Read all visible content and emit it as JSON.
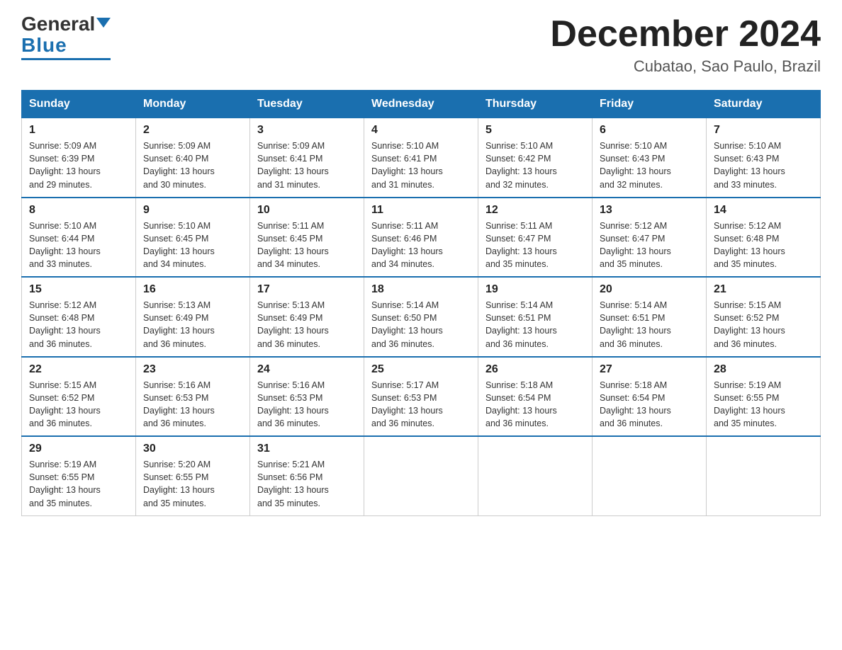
{
  "header": {
    "logo_general": "General",
    "logo_blue": "Blue",
    "month_title": "December 2024",
    "subtitle": "Cubatao, Sao Paulo, Brazil"
  },
  "days_of_week": [
    "Sunday",
    "Monday",
    "Tuesday",
    "Wednesday",
    "Thursday",
    "Friday",
    "Saturday"
  ],
  "weeks": [
    [
      {
        "day": "1",
        "sunrise": "5:09 AM",
        "sunset": "6:39 PM",
        "daylight": "13 hours and 29 minutes."
      },
      {
        "day": "2",
        "sunrise": "5:09 AM",
        "sunset": "6:40 PM",
        "daylight": "13 hours and 30 minutes."
      },
      {
        "day": "3",
        "sunrise": "5:09 AM",
        "sunset": "6:41 PM",
        "daylight": "13 hours and 31 minutes."
      },
      {
        "day": "4",
        "sunrise": "5:10 AM",
        "sunset": "6:41 PM",
        "daylight": "13 hours and 31 minutes."
      },
      {
        "day": "5",
        "sunrise": "5:10 AM",
        "sunset": "6:42 PM",
        "daylight": "13 hours and 32 minutes."
      },
      {
        "day": "6",
        "sunrise": "5:10 AM",
        "sunset": "6:43 PM",
        "daylight": "13 hours and 32 minutes."
      },
      {
        "day": "7",
        "sunrise": "5:10 AM",
        "sunset": "6:43 PM",
        "daylight": "13 hours and 33 minutes."
      }
    ],
    [
      {
        "day": "8",
        "sunrise": "5:10 AM",
        "sunset": "6:44 PM",
        "daylight": "13 hours and 33 minutes."
      },
      {
        "day": "9",
        "sunrise": "5:10 AM",
        "sunset": "6:45 PM",
        "daylight": "13 hours and 34 minutes."
      },
      {
        "day": "10",
        "sunrise": "5:11 AM",
        "sunset": "6:45 PM",
        "daylight": "13 hours and 34 minutes."
      },
      {
        "day": "11",
        "sunrise": "5:11 AM",
        "sunset": "6:46 PM",
        "daylight": "13 hours and 34 minutes."
      },
      {
        "day": "12",
        "sunrise": "5:11 AM",
        "sunset": "6:47 PM",
        "daylight": "13 hours and 35 minutes."
      },
      {
        "day": "13",
        "sunrise": "5:12 AM",
        "sunset": "6:47 PM",
        "daylight": "13 hours and 35 minutes."
      },
      {
        "day": "14",
        "sunrise": "5:12 AM",
        "sunset": "6:48 PM",
        "daylight": "13 hours and 35 minutes."
      }
    ],
    [
      {
        "day": "15",
        "sunrise": "5:12 AM",
        "sunset": "6:48 PM",
        "daylight": "13 hours and 36 minutes."
      },
      {
        "day": "16",
        "sunrise": "5:13 AM",
        "sunset": "6:49 PM",
        "daylight": "13 hours and 36 minutes."
      },
      {
        "day": "17",
        "sunrise": "5:13 AM",
        "sunset": "6:49 PM",
        "daylight": "13 hours and 36 minutes."
      },
      {
        "day": "18",
        "sunrise": "5:14 AM",
        "sunset": "6:50 PM",
        "daylight": "13 hours and 36 minutes."
      },
      {
        "day": "19",
        "sunrise": "5:14 AM",
        "sunset": "6:51 PM",
        "daylight": "13 hours and 36 minutes."
      },
      {
        "day": "20",
        "sunrise": "5:14 AM",
        "sunset": "6:51 PM",
        "daylight": "13 hours and 36 minutes."
      },
      {
        "day": "21",
        "sunrise": "5:15 AM",
        "sunset": "6:52 PM",
        "daylight": "13 hours and 36 minutes."
      }
    ],
    [
      {
        "day": "22",
        "sunrise": "5:15 AM",
        "sunset": "6:52 PM",
        "daylight": "13 hours and 36 minutes."
      },
      {
        "day": "23",
        "sunrise": "5:16 AM",
        "sunset": "6:53 PM",
        "daylight": "13 hours and 36 minutes."
      },
      {
        "day": "24",
        "sunrise": "5:16 AM",
        "sunset": "6:53 PM",
        "daylight": "13 hours and 36 minutes."
      },
      {
        "day": "25",
        "sunrise": "5:17 AM",
        "sunset": "6:53 PM",
        "daylight": "13 hours and 36 minutes."
      },
      {
        "day": "26",
        "sunrise": "5:18 AM",
        "sunset": "6:54 PM",
        "daylight": "13 hours and 36 minutes."
      },
      {
        "day": "27",
        "sunrise": "5:18 AM",
        "sunset": "6:54 PM",
        "daylight": "13 hours and 36 minutes."
      },
      {
        "day": "28",
        "sunrise": "5:19 AM",
        "sunset": "6:55 PM",
        "daylight": "13 hours and 35 minutes."
      }
    ],
    [
      {
        "day": "29",
        "sunrise": "5:19 AM",
        "sunset": "6:55 PM",
        "daylight": "13 hours and 35 minutes."
      },
      {
        "day": "30",
        "sunrise": "5:20 AM",
        "sunset": "6:55 PM",
        "daylight": "13 hours and 35 minutes."
      },
      {
        "day": "31",
        "sunrise": "5:21 AM",
        "sunset": "6:56 PM",
        "daylight": "13 hours and 35 minutes."
      },
      null,
      null,
      null,
      null
    ]
  ],
  "labels": {
    "sunrise": "Sunrise: ",
    "sunset": "Sunset: ",
    "daylight": "Daylight: "
  }
}
